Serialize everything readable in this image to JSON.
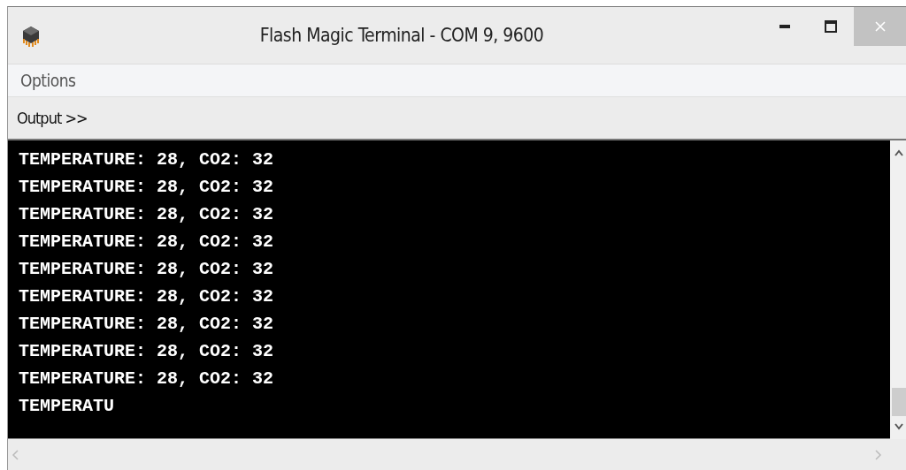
{
  "window": {
    "title": "Flash Magic Terminal - COM 9, 9600"
  },
  "menu": [
    "Options"
  ],
  "output_label": "Output >>",
  "terminal_lines": [
    "TEMPERATURE: 28, CO2: 32",
    "TEMPERATURE: 28, CO2: 32",
    "TEMPERATURE: 28, CO2: 32",
    "TEMPERATURE: 28, CO2: 32",
    "TEMPERATURE: 28, CO2: 32",
    "TEMPERATURE: 28, CO2: 32",
    "TEMPERATURE: 28, CO2: 32",
    "TEMPERATURE: 28, CO2: 32",
    "TEMPERATURE: 28, CO2: 32",
    "TEMPERATU"
  ]
}
